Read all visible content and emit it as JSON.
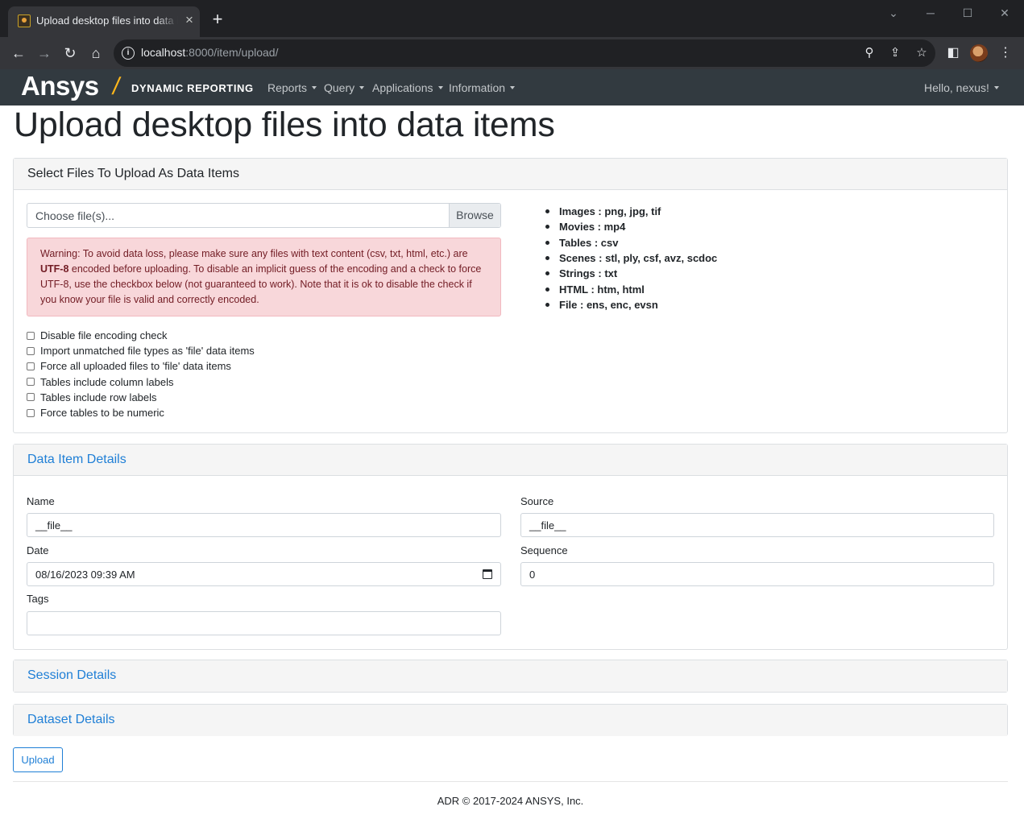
{
  "browser": {
    "tab_title": "Upload desktop files into data items",
    "url_host": "localhost",
    "url_path": ":8000/item/upload/",
    "info_glyph": "i"
  },
  "navbar": {
    "brand": "Ansys",
    "brand_sub": "DYNAMIC REPORTING",
    "items": [
      {
        "label": "Reports"
      },
      {
        "label": "Query"
      },
      {
        "label": "Applications"
      },
      {
        "label": "Information"
      }
    ],
    "user": "Hello, nexus!"
  },
  "page_title": "Upload desktop files into data items",
  "select_section": {
    "header": "Select Files To Upload As Data Items",
    "file_placeholder": "Choose file(s)...",
    "browse_label": "Browse",
    "warning_prefix": "Warning: To avoid data loss, please make sure any files with text content (csv, txt, html, etc.) are ",
    "warning_bold": "UTF-8",
    "warning_suffix": " encoded before uploading. To disable an implicit guess of the encoding and a check to force UTF-8, use the checkbox below (not guaranteed to work). Note that it is ok to disable the check if you know your file is valid and correctly encoded.",
    "checkboxes": [
      {
        "label": "Disable file encoding check",
        "checked": false
      },
      {
        "label": "Import unmatched file types as 'file' data items",
        "checked": false
      },
      {
        "label": "Force all uploaded files to 'file' data items",
        "checked": false
      },
      {
        "label": "Tables include column labels",
        "checked": false
      },
      {
        "label": "Tables include row labels",
        "checked": false
      },
      {
        "label": "Force tables to be numeric",
        "checked": false
      }
    ],
    "file_types": [
      "Images : png, jpg, tif",
      "Movies : mp4",
      "Tables : csv",
      "Scenes : stl, ply, csf, avz, scdoc",
      "Strings : txt",
      "HTML : htm, html",
      "File : ens, enc, evsn"
    ]
  },
  "details": {
    "header": "Data Item Details",
    "name_label": "Name",
    "name_value": "__file__",
    "source_label": "Source",
    "source_value": "__file__",
    "date_label": "Date",
    "date_value": "08/16/2023 09:39 AM",
    "sequence_label": "Sequence",
    "sequence_value": "0",
    "tags_label": "Tags",
    "tags_value": ""
  },
  "session_header": "Session Details",
  "dataset_header": "Dataset Details",
  "upload_label": "Upload",
  "footer": "ADR © 2017-2024 ANSYS, Inc.",
  "colors": {
    "accent": "#1f7fd6",
    "brand": "#ffb71b",
    "navbar_bg": "#323a40",
    "alert_bg": "#f8d7da",
    "alert_text": "#721c24"
  }
}
